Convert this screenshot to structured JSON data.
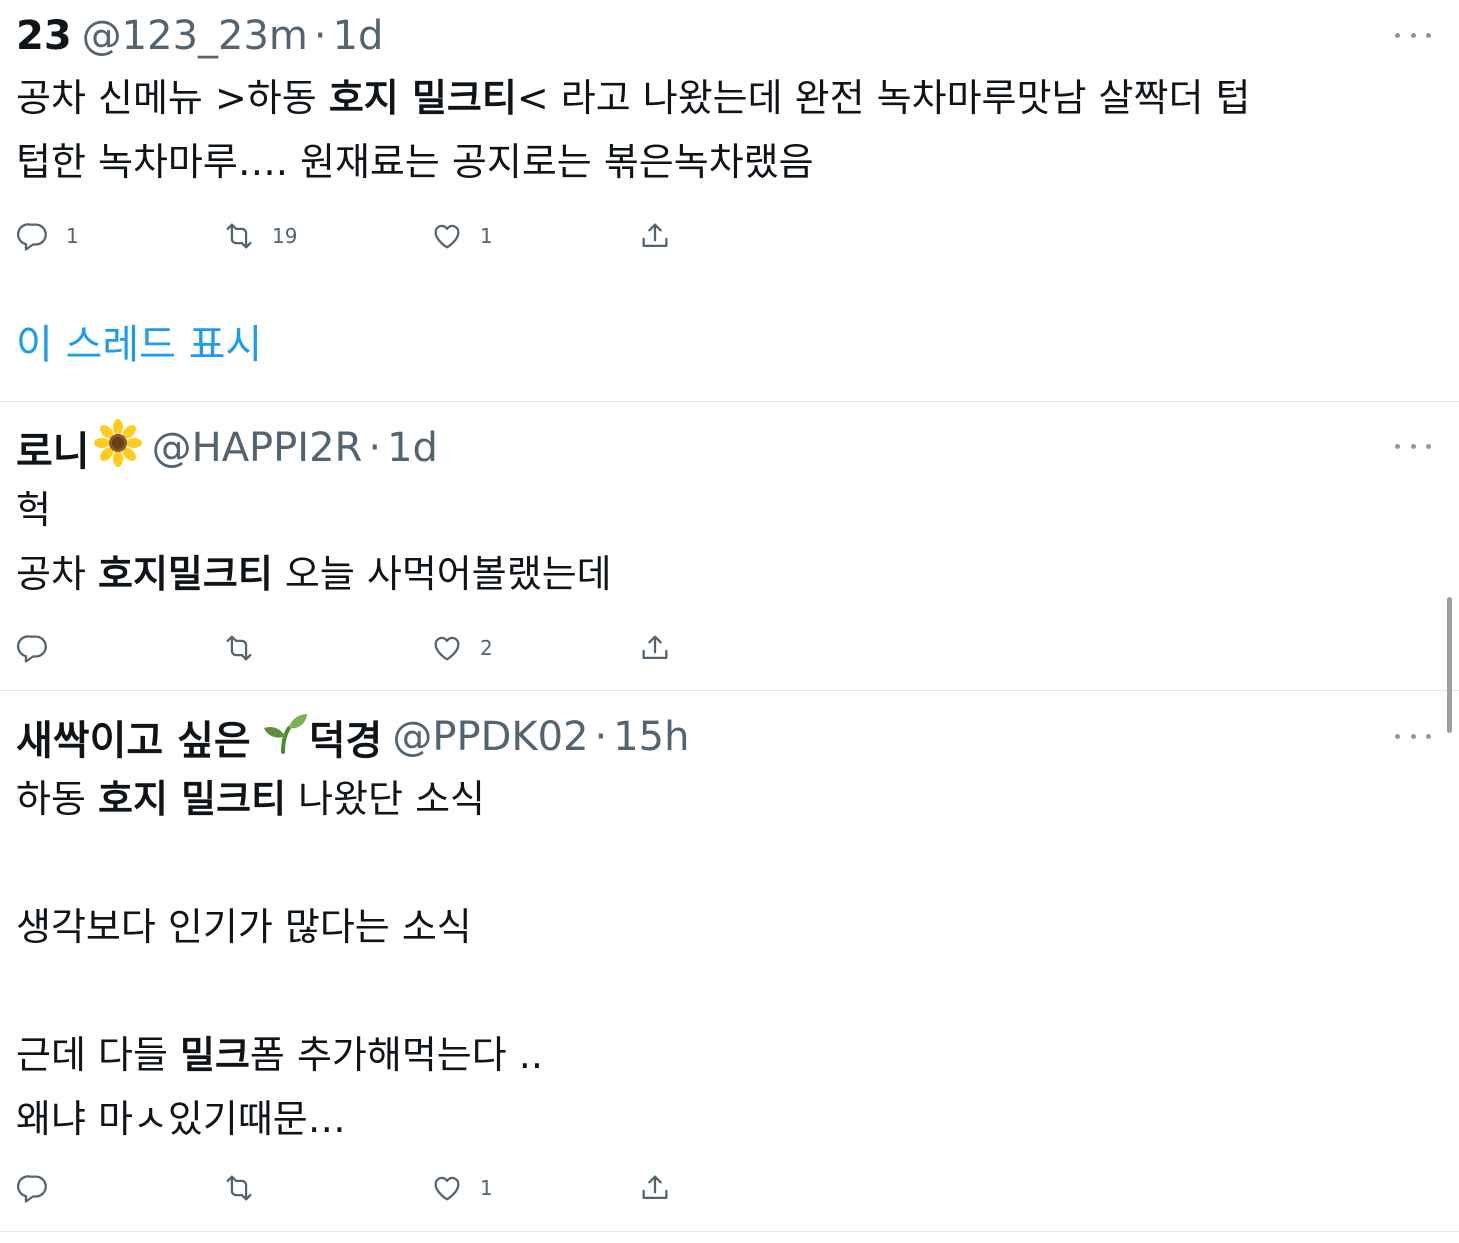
{
  "tweets": [
    {
      "display_name": "23",
      "handle": "@123_23m",
      "separator": "·",
      "time": "1d",
      "lines": [
        [
          {
            "t": "공차 신메뉴 >하동 ",
            "b": false
          },
          {
            "t": "호지 밀크티",
            "b": true
          },
          {
            "t": "< 라고 나왔는데 완전 녹차마루맛남 살짝더 텁",
            "b": false
          }
        ],
        [
          {
            "t": "텁한 녹차마루…. 원재료는 공지로는 볶은녹차랬음",
            "b": false
          }
        ]
      ],
      "reply_count": "1",
      "retweet_count": "19",
      "like_count": "1"
    },
    {
      "display_name": "로니",
      "name_emoji": "sunflower-emoji",
      "handle": "@HAPPI2R",
      "separator": "·",
      "time": "1d",
      "lines": [
        [
          {
            "t": "헉",
            "b": false
          }
        ],
        [
          {
            "t": "공차 ",
            "b": false
          },
          {
            "t": "호지밀크티",
            "b": true
          },
          {
            "t": " 오늘 사먹어볼랬는데",
            "b": false
          }
        ]
      ],
      "reply_count": "",
      "retweet_count": "",
      "like_count": "2"
    },
    {
      "display_name": "새싹이고 싶은",
      "name_emoji": "seedling-emoji",
      "display_name_suffix": "덕경",
      "handle": "@PPDK02",
      "separator": "·",
      "time": "15h",
      "lines": [
        [
          {
            "t": "하동 ",
            "b": false
          },
          {
            "t": "호지 밀크티",
            "b": true
          },
          {
            "t": " 나왔단 소식",
            "b": false
          }
        ],
        [],
        [
          {
            "t": "생각보다 인기가 많다는 소식",
            "b": false
          }
        ],
        [],
        [
          {
            "t": "근데 다들 ",
            "b": false
          },
          {
            "t": "밀크",
            "b": true
          },
          {
            "t": "폼 추가해먹는다 ..",
            "b": false
          }
        ],
        [
          {
            "t": "왜냐 마ㅅ있기때문…",
            "b": false
          }
        ]
      ],
      "reply_count": "",
      "retweet_count": "",
      "like_count": "1"
    }
  ],
  "show_thread_label": "이 스레드 표시",
  "icons": {
    "reply": "reply-icon",
    "retweet": "retweet-icon",
    "like": "heart-icon",
    "share": "share-icon",
    "more": "more-icon"
  },
  "colors": {
    "link": "#1d9bf0",
    "secondary_text": "#536471",
    "primary_text": "#0f1419",
    "divider": "#e1e6ea"
  }
}
